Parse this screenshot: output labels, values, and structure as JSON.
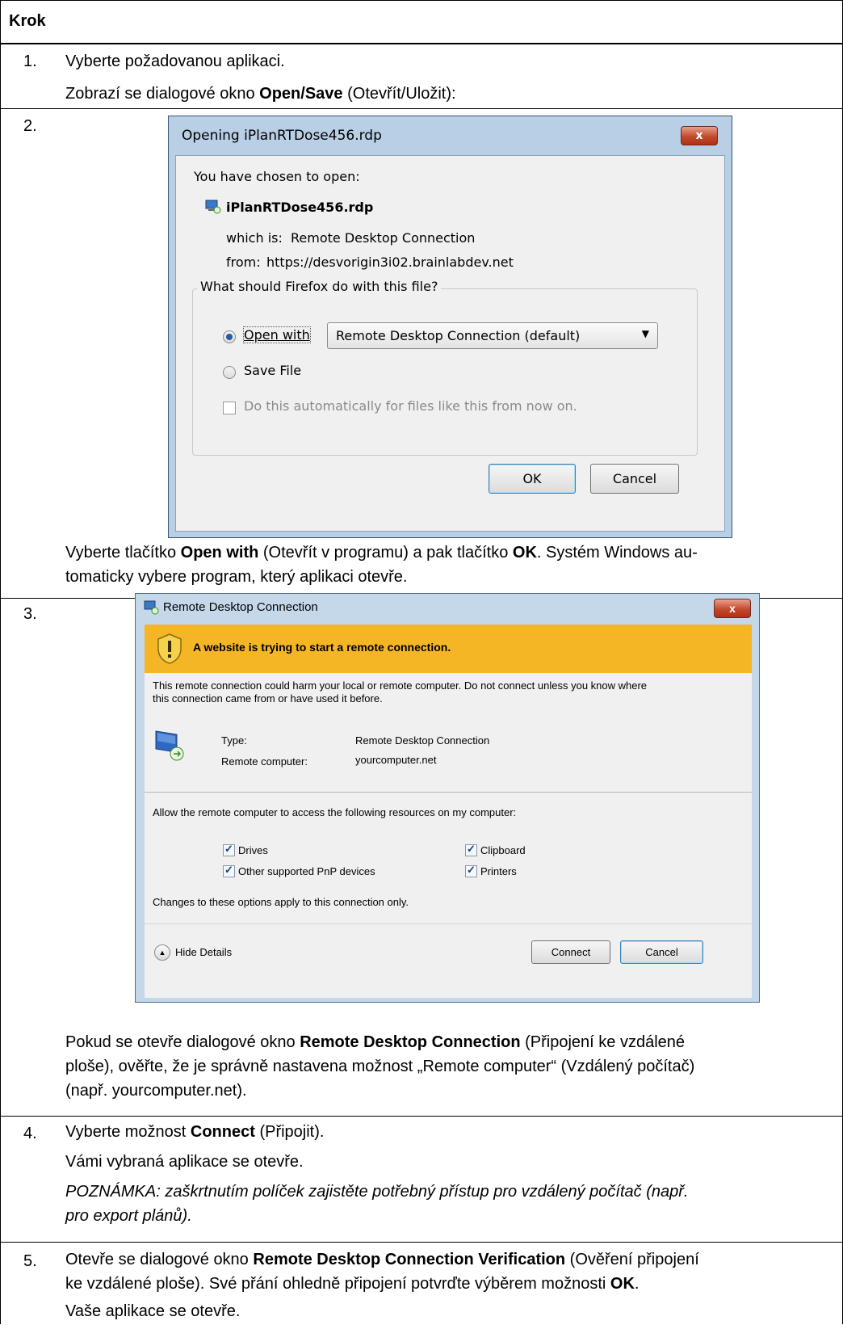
{
  "header": {
    "label": "Krok"
  },
  "steps": [
    {
      "num": "1.",
      "lines": [
        "Vyberte požadovanou aplikaci.",
        "Zobrazí se dialogové okno ",
        "Open/Save",
        " (Otevřít/Uložit):"
      ]
    },
    {
      "num": "2.",
      "text_a": "Vyberte tlačítko ",
      "bold_a": "Open with",
      "text_b": " (Otevřít v programu) a pak tlačítko ",
      "bold_b": "OK",
      "text_c": ". Systém Windows au-",
      "line2": "tomaticky vybere program, který aplikaci otevře."
    },
    {
      "num": "3.",
      "l1a": "Pokud se otevře dialogové okno ",
      "l1b": "Remote Desktop Connection",
      "l1c": " (Připojení ke vzdálené",
      "l2": "ploše), ověřte, že je správně nastavena možnost „Remote computer“ (Vzdálený počítač)",
      "l3": "(např. yourcomputer.net)."
    },
    {
      "num": "4.",
      "l1a": "Vyberte možnost ",
      "l1b": "Connect",
      "l1c": " (Připojit).",
      "l2": "Vámi vybraná aplikace se otevře.",
      "l3": "POZNÁMKA: zaškrtnutím políček zajistěte potřebný přístup pro vzdálený počítač (např.",
      "l4": "pro export plánů)."
    },
    {
      "num": "5.",
      "l1a": "Otevře se dialogové okno ",
      "l1b": "Remote Desktop Connection Verification",
      "l1c": " (Ověření připojení",
      "l2a": "ke vzdálené ploše). Své přání ohledně připojení potvrďte výběrem možnosti ",
      "l2b": "OK",
      "l2c": ".",
      "l3": "Vaše aplikace se otevře."
    }
  ],
  "firefox_dialog": {
    "title": "Opening iPlanRTDose456.rdp",
    "close": "x",
    "chosen": "You have chosen to open:",
    "filename": "iPlanRTDose456.rdp",
    "which_is_label": "which is:",
    "which_is_value": "Remote Desktop Connection",
    "from_label": "from:",
    "from_value": "https://desvorigin3i02.brainlabdev.net",
    "group_label": "What should Firefox do with this file?",
    "open_with": "Open with",
    "open_with_value": "Remote Desktop Connection (default)",
    "save_file": "Save File",
    "auto_label": "Do this automatically for files like this from now on.",
    "ok": "OK",
    "cancel": "Cancel"
  },
  "rdp_dialog": {
    "title": "Remote Desktop Connection",
    "close": "x",
    "warning": "A website is trying to start a remote connection.",
    "desc1": "This remote connection could harm your local or remote computer. Do not connect unless you know where",
    "desc2": "this connection came from or have used it before.",
    "type_label": "Type:",
    "type_value": "Remote Desktop Connection",
    "remote_label": "Remote computer:",
    "remote_value": "yourcomputer.net",
    "allow": "Allow the remote computer to access the following resources on my computer:",
    "drives": "Drives",
    "clipboard": "Clipboard",
    "pnp": "Other supported PnP devices",
    "printers": "Printers",
    "changes": "Changes to these options apply to this connection only.",
    "hide_details": "Hide Details",
    "connect": "Connect",
    "cancel": "Cancel"
  }
}
